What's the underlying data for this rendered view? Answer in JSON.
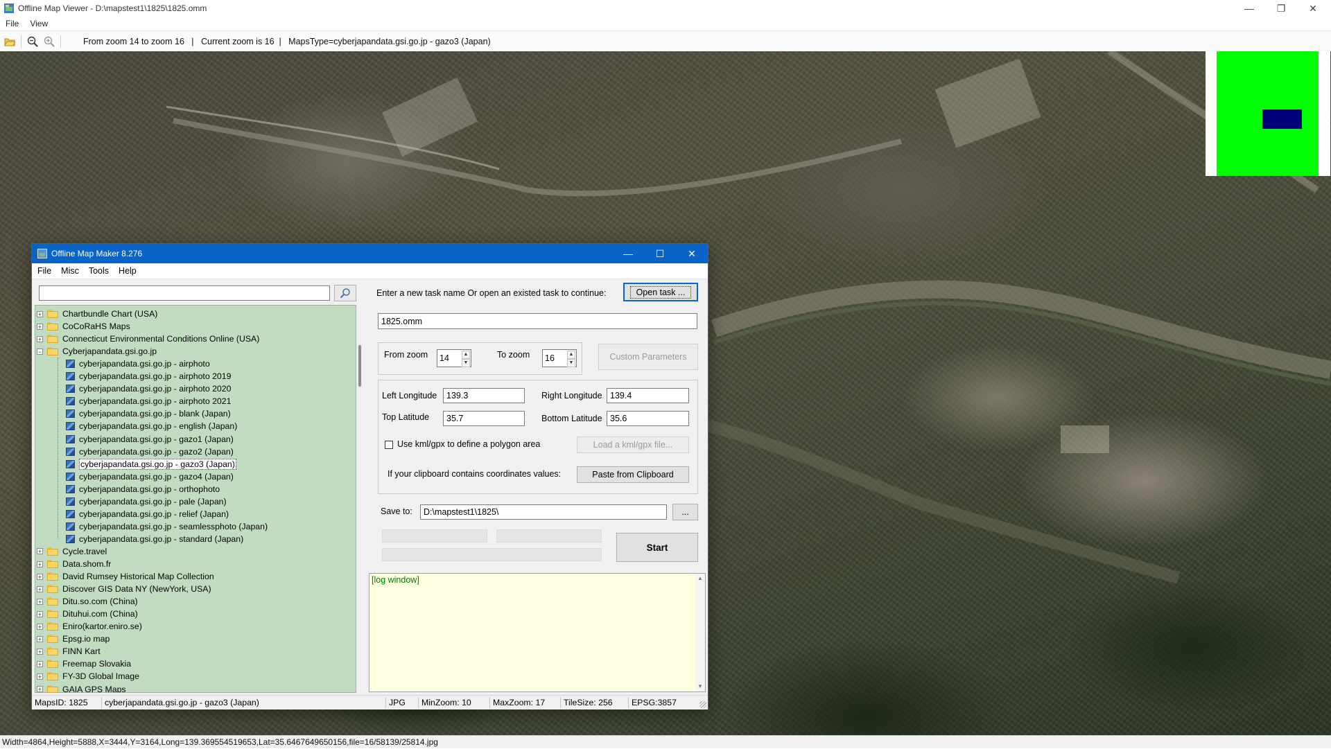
{
  "viewer": {
    "title": "Offline Map Viewer - D:\\mapstest1\\1825\\1825.omm",
    "menu": [
      "File",
      "View"
    ],
    "toolbar_info": "From zoom 14 to zoom 16   |   Current zoom is 16  |   MapsType=cyberjapandata.gsi.go.jp - gazo3 (Japan)",
    "status": "Width=4864,Height=5888,X=3444,Y=3164,Long=139.369554519653,Lat=35.6467649650156,file=16/58139/25814.jpg",
    "icons": [
      "open-folder-icon",
      "zoom-out-icon",
      "zoom-in-icon"
    ]
  },
  "maker": {
    "title": "Offline Map Maker 8.276",
    "menu": [
      "File",
      "Misc",
      "Tools",
      "Help"
    ],
    "search_value": "",
    "tree": [
      {
        "label": "Chartbundle Chart (USA)",
        "kind": "folder"
      },
      {
        "label": "CoCoRaHS Maps",
        "kind": "folder"
      },
      {
        "label": "Connecticut Environmental Conditions Online (USA)",
        "kind": "folder"
      },
      {
        "label": "Cyberjapandata.gsi.go.jp",
        "kind": "folder-open"
      },
      {
        "label": "cyberjapandata.gsi.go.jp - airphoto",
        "kind": "map"
      },
      {
        "label": "cyberjapandata.gsi.go.jp - airphoto 2019",
        "kind": "map"
      },
      {
        "label": "cyberjapandata.gsi.go.jp - airphoto 2020",
        "kind": "map"
      },
      {
        "label": "cyberjapandata.gsi.go.jp - airphoto 2021",
        "kind": "map"
      },
      {
        "label": "cyberjapandata.gsi.go.jp - blank (Japan)",
        "kind": "map"
      },
      {
        "label": "cyberjapandata.gsi.go.jp - english (Japan)",
        "kind": "map"
      },
      {
        "label": "cyberjapandata.gsi.go.jp - gazo1 (Japan)",
        "kind": "map"
      },
      {
        "label": "cyberjapandata.gsi.go.jp - gazo2 (Japan)",
        "kind": "map"
      },
      {
        "label": "cyberjapandata.gsi.go.jp - gazo3 (Japan)",
        "kind": "map",
        "selected": true
      },
      {
        "label": "cyberjapandata.gsi.go.jp - gazo4 (Japan)",
        "kind": "map"
      },
      {
        "label": "cyberjapandata.gsi.go.jp - orthophoto",
        "kind": "map"
      },
      {
        "label": "cyberjapandata.gsi.go.jp - pale (Japan)",
        "kind": "map"
      },
      {
        "label": "cyberjapandata.gsi.go.jp - relief (Japan)",
        "kind": "map"
      },
      {
        "label": "cyberjapandata.gsi.go.jp - seamlessphoto (Japan)",
        "kind": "map"
      },
      {
        "label": "cyberjapandata.gsi.go.jp - standard (Japan)",
        "kind": "map"
      },
      {
        "label": "Cycle.travel",
        "kind": "folder"
      },
      {
        "label": "Data.shom.fr",
        "kind": "folder"
      },
      {
        "label": "David Rumsey Historical Map Collection",
        "kind": "folder"
      },
      {
        "label": "Discover GIS Data NY (NewYork, USA)",
        "kind": "folder"
      },
      {
        "label": "Ditu.so.com (China)",
        "kind": "folder"
      },
      {
        "label": "Dituhui.com (China)",
        "kind": "folder"
      },
      {
        "label": "Eniro(kartor.eniro.se)",
        "kind": "folder"
      },
      {
        "label": "Epsg.io map",
        "kind": "folder"
      },
      {
        "label": "FINN Kart",
        "kind": "folder"
      },
      {
        "label": "Freemap Slovakia",
        "kind": "folder"
      },
      {
        "label": "FY-3D Global Image",
        "kind": "folder"
      },
      {
        "label": "GAIA GPS Maps",
        "kind": "folder"
      }
    ],
    "task_prompt": "Enter a new task name Or open an existed task to continue:",
    "open_task_label": "Open task ...",
    "task_name": "1825.omm",
    "from_zoom_label": "From zoom",
    "from_zoom": "14",
    "to_zoom_label": "To zoom",
    "to_zoom": "16",
    "custom_params_label": "Custom Parameters",
    "left_lon_label": "Left Longitude",
    "left_lon": "139.3",
    "right_lon_label": "Right Longitude",
    "right_lon": "139.4",
    "top_lat_label": "Top Latitude",
    "top_lat": "35.7",
    "bottom_lat_label": "Bottom Latitude",
    "bottom_lat": "35.6",
    "kml_checkbox_label": "Use kml/gpx to define a polygon area",
    "kml_checked": false,
    "load_kml_label": "Load a kml/gpx file...",
    "clipboard_prompt": "If your clipboard contains coordinates values:",
    "paste_label": "Paste from Clipboard",
    "save_to_label": "Save to:",
    "save_to": "D:\\mapstest1\\1825\\",
    "browse_label": "...",
    "start_label": "Start",
    "log_text": "[log window]",
    "status": {
      "maps_id": "MapsID: 1825",
      "maps_name": "cyberjapandata.gsi.go.jp - gazo3 (Japan)",
      "format": "JPG",
      "min_zoom": "MinZoom: 10",
      "max_zoom": "MaxZoom: 17",
      "tile_size": "TileSize: 256",
      "epsg": "EPSG:3857"
    }
  },
  "colors": {
    "titlebar_blue": "#0a64c8",
    "tree_bg": "#c1dcc0",
    "log_bg": "#ffffe1",
    "log_text": "#007d00",
    "minimap_green": "#00ff00",
    "minimap_view": "#00007a"
  }
}
